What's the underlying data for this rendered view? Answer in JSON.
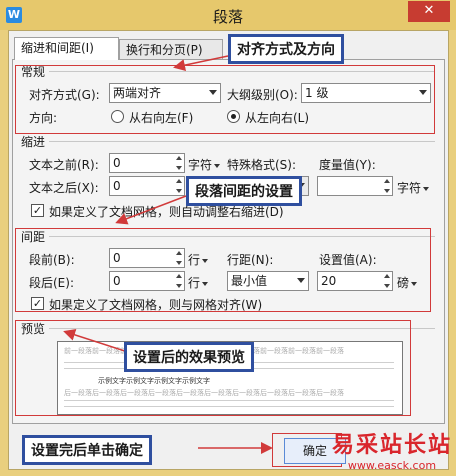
{
  "window": {
    "title": "段落",
    "close_glyph": "✕",
    "app_icon_letter": "W"
  },
  "tabs": [
    {
      "label": "缩进和间距(I)",
      "active": true
    },
    {
      "label": "换行和分页(P)",
      "active": false
    }
  ],
  "general": {
    "section": "常规",
    "alignment_label": "对齐方式(G):",
    "alignment_value": "两端对齐",
    "outline_label": "大纲级别(O):",
    "outline_value": "1 级",
    "direction_label": "方向:",
    "rtl_label": "从右向左(F)",
    "ltr_label": "从左向右(L)"
  },
  "indent": {
    "section": "缩进",
    "before_label": "文本之前(R):",
    "before_value": "0",
    "after_label": "文本之后(X):",
    "after_value": "0",
    "unit": "字符",
    "special_label": "特殊格式(S):",
    "measure_label": "度量值(Y):",
    "measure_unit": "字符",
    "grid_check": "如果定义了文档网格，则自动调整右缩进(D)"
  },
  "spacing": {
    "section": "间距",
    "before_label": "段前(B):",
    "before_value": "0",
    "before_unit": "行",
    "after_label": "段后(E):",
    "after_value": "0",
    "after_unit": "行",
    "line_label": "行距(N):",
    "line_value": "最小值",
    "setting_label": "设置值(A):",
    "setting_value": "20",
    "setting_unit": "磅",
    "grid_check": "如果定义了文档网格，则与网格对齐(W)"
  },
  "preview": {
    "section": "预览",
    "sample_prev": "前一段落前一段落前一段落前一段落前一段落前一段落前一段落前一段落前一段落前一段落",
    "sample_cur": "示例文字示例文字示例文字示例文字",
    "sample_next": "后一段落后一段落后一段落后一段落后一段落后一段落后一段落后一段落后一段落后一段落"
  },
  "buttons": {
    "ok": "确定"
  },
  "annotations": {
    "align": "对齐方式及方向",
    "spacing": "段落间距的设置",
    "preview": "设置后的效果预览",
    "ok": "设置完后单击确定"
  },
  "watermark": {
    "main": "易采站长站",
    "url": "www.easck.com"
  },
  "colors": {
    "annotation_border": "#2f4f9f",
    "highlight": "#d13a3a",
    "watermark": "#d9262c"
  }
}
